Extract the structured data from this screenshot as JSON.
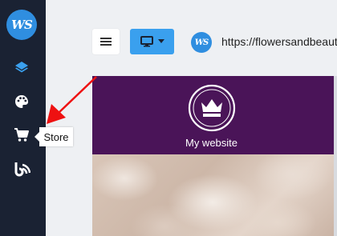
{
  "sidebar": {
    "logo_text": "WS",
    "items": [
      {
        "icon": "layers-icon",
        "label": ""
      },
      {
        "icon": "palette-icon",
        "label": ""
      },
      {
        "icon": "cart-icon",
        "label": "Store"
      },
      {
        "icon": "blog-icon",
        "label": ""
      }
    ],
    "tooltip": "Store"
  },
  "toolbar": {
    "menu_icon": "hamburger-icon",
    "device_icon": "desktop-icon",
    "url": "https://flowersandbeauty.",
    "site_logo_text": "WS"
  },
  "preview": {
    "site_title": "My website",
    "header_color": "#4a1458"
  },
  "colors": {
    "sidebar_bg": "#1a2233",
    "accent": "#3aa0ee",
    "annotation_arrow": "#ee1111"
  }
}
